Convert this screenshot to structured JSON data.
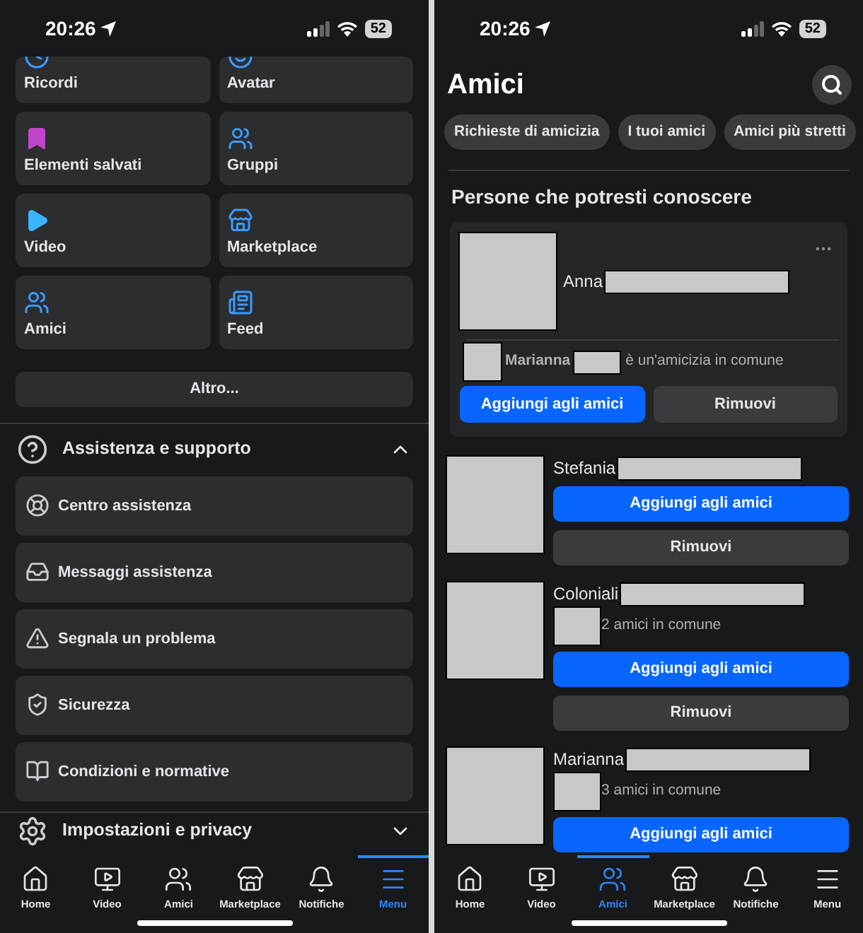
{
  "menu_screen": {
    "status_bar": {
      "time": "20:26",
      "battery": "52"
    },
    "shortcuts": [
      {
        "label": "Ricordi"
      },
      {
        "label": "Avatar"
      },
      {
        "label": "Elementi salvati"
      },
      {
        "label": "Gruppi"
      },
      {
        "label": "Video"
      },
      {
        "label": "Marketplace"
      },
      {
        "label": "Amici"
      },
      {
        "label": "Feed"
      }
    ],
    "more_button": "Altro...",
    "sections": [
      {
        "title": "Assistenza e supporto",
        "expanded": true,
        "items": [
          "Centro assistenza",
          "Messaggi assistenza",
          "Segnala un problema",
          "Sicurezza",
          "Condizioni e normative"
        ]
      },
      {
        "title": "Impostazioni e privacy",
        "expanded": false
      }
    ],
    "tab_bar": [
      {
        "label": "Home",
        "selected": false
      },
      {
        "label": "Video",
        "selected": false
      },
      {
        "label": "Amici",
        "selected": false
      },
      {
        "label": "Marketplace",
        "selected": false
      },
      {
        "label": "Notifiche",
        "selected": false
      },
      {
        "label": "Menu",
        "selected": true
      }
    ]
  },
  "friends_screen": {
    "status_bar": {
      "time": "20:26",
      "battery": "52"
    },
    "title": "Amici",
    "chips": [
      "Richieste di amicizia",
      "I tuoi amici",
      "Amici più stretti"
    ],
    "section_title": "Persone che potresti conoscere",
    "featured": {
      "name": "Anna",
      "mutual_name": "Marianna",
      "mutual_text": "è un'amicizia in comune",
      "add_button": "Aggiungi agli amici",
      "remove_button": "Rimuovi"
    },
    "people": [
      {
        "name": "Stefania",
        "add_button": "Aggiungi agli amici",
        "remove_button": "Rimuovi"
      },
      {
        "name": "Coloniali",
        "mutual": "2 amici in comune",
        "add_button": "Aggiungi agli amici",
        "remove_button": "Rimuovi"
      },
      {
        "name": "Marianna",
        "mutual": "3 amici in comune",
        "add_button": "Aggiungi agli amici"
      }
    ],
    "tab_bar": [
      {
        "label": "Home",
        "selected": false
      },
      {
        "label": "Video",
        "selected": false
      },
      {
        "label": "Amici",
        "selected": true
      },
      {
        "label": "Marketplace",
        "selected": false
      },
      {
        "label": "Notifiche",
        "selected": false
      },
      {
        "label": "Menu",
        "selected": false
      }
    ]
  }
}
